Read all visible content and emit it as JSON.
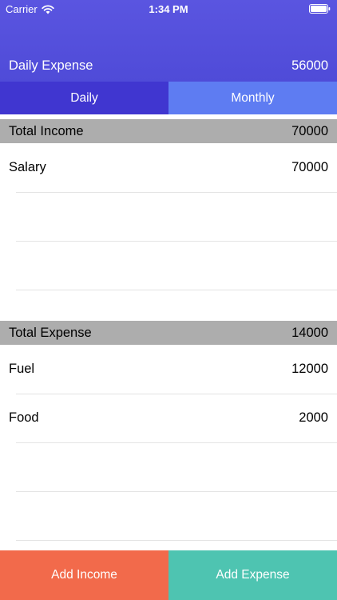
{
  "status_bar": {
    "carrier": "Carrier",
    "time": "1:34 PM"
  },
  "header": {
    "title": "Daily Expense",
    "value": "56000"
  },
  "tabs": [
    {
      "label": "Daily"
    },
    {
      "label": "Monthly"
    }
  ],
  "income": {
    "header_label": "Total Income",
    "header_value": "70000",
    "items": [
      {
        "label": "Salary",
        "value": "70000"
      }
    ]
  },
  "expense": {
    "header_label": "Total Expense",
    "header_value": "14000",
    "items": [
      {
        "label": "Fuel",
        "value": "12000"
      },
      {
        "label": "Food",
        "value": "2000"
      }
    ]
  },
  "buttons": {
    "add_income": "Add Income",
    "add_expense": "Add Expense"
  },
  "colors": {
    "header": "#5a55e0",
    "tab_daily": "#4036d0",
    "tab_monthly": "#5e7cf2",
    "section_header": "#adadad",
    "add_income": "#f26a4b",
    "add_expense": "#4ec4b1"
  }
}
